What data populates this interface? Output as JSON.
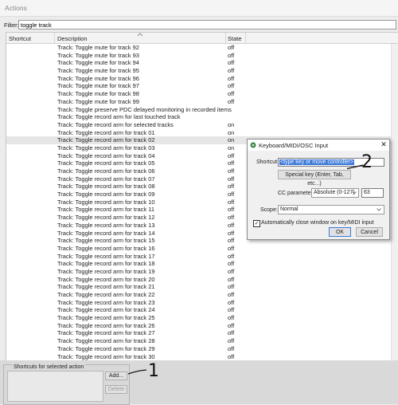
{
  "window": {
    "title": "Actions"
  },
  "filter": {
    "label": "Filter:",
    "value": "toggle track"
  },
  "columns": {
    "shortcut": "Shortcut",
    "description": "Description",
    "state": "State"
  },
  "rows": [
    {
      "description": "Track: Toggle mute for track 92",
      "state": "off"
    },
    {
      "description": "Track: Toggle mute for track 93",
      "state": "off"
    },
    {
      "description": "Track: Toggle mute for track 94",
      "state": "off"
    },
    {
      "description": "Track: Toggle mute for track 95",
      "state": "off"
    },
    {
      "description": "Track: Toggle mute for track 96",
      "state": "off"
    },
    {
      "description": "Track: Toggle mute for track 97",
      "state": "off"
    },
    {
      "description": "Track: Toggle mute for track 98",
      "state": "off"
    },
    {
      "description": "Track: Toggle mute for track 99",
      "state": "off"
    },
    {
      "description": "Track: Toggle preserve PDC delayed monitoring in recorded items",
      "state": ""
    },
    {
      "description": "Track: Toggle record arm for last touched track",
      "state": ""
    },
    {
      "description": "Track: Toggle record arm for selected tracks",
      "state": "on"
    },
    {
      "description": "Track: Toggle record arm for track 01",
      "state": "on"
    },
    {
      "description": "Track: Toggle record arm for track 02",
      "state": "on",
      "selected": true
    },
    {
      "description": "Track: Toggle record arm for track 03",
      "state": "on"
    },
    {
      "description": "Track: Toggle record arm for track 04",
      "state": "off"
    },
    {
      "description": "Track: Toggle record arm for track 05",
      "state": "off"
    },
    {
      "description": "Track: Toggle record arm for track 06",
      "state": "off"
    },
    {
      "description": "Track: Toggle record arm for track 07",
      "state": "off"
    },
    {
      "description": "Track: Toggle record arm for track 08",
      "state": "off"
    },
    {
      "description": "Track: Toggle record arm for track 09",
      "state": "off"
    },
    {
      "description": "Track: Toggle record arm for track 10",
      "state": "off"
    },
    {
      "description": "Track: Toggle record arm for track 11",
      "state": "off"
    },
    {
      "description": "Track: Toggle record arm for track 12",
      "state": "off"
    },
    {
      "description": "Track: Toggle record arm for track 13",
      "state": "off"
    },
    {
      "description": "Track: Toggle record arm for track 14",
      "state": "off"
    },
    {
      "description": "Track: Toggle record arm for track 15",
      "state": "off"
    },
    {
      "description": "Track: Toggle record arm for track 16",
      "state": "off"
    },
    {
      "description": "Track: Toggle record arm for track 17",
      "state": "off"
    },
    {
      "description": "Track: Toggle record arm for track 18",
      "state": "off"
    },
    {
      "description": "Track: Toggle record arm for track 19",
      "state": "off"
    },
    {
      "description": "Track: Toggle record arm for track 20",
      "state": "off"
    },
    {
      "description": "Track: Toggle record arm for track 21",
      "state": "off"
    },
    {
      "description": "Track: Toggle record arm for track 22",
      "state": "off"
    },
    {
      "description": "Track: Toggle record arm for track 23",
      "state": "off"
    },
    {
      "description": "Track: Toggle record arm for track 24",
      "state": "off"
    },
    {
      "description": "Track: Toggle record arm for track 25",
      "state": "off"
    },
    {
      "description": "Track: Toggle record arm for track 26",
      "state": "off"
    },
    {
      "description": "Track: Toggle record arm for track 27",
      "state": "off"
    },
    {
      "description": "Track: Toggle record arm for track 28",
      "state": "off"
    },
    {
      "description": "Track: Toggle record arm for track 29",
      "state": "off"
    },
    {
      "description": "Track: Toggle record arm for track 30",
      "state": "off"
    }
  ],
  "bottom": {
    "group_label": "Shortcuts for selected action",
    "add_label": "Add...",
    "delete_label": "Delete"
  },
  "dialog": {
    "title": "Keyboard/MIDI/OSC Input",
    "close_glyph": "✕",
    "shortcut_label": "Shortcut:",
    "shortcut_value": "<type key or move controller>",
    "special_key_label": "Special key (Enter, Tab, etc...)",
    "cc_label": "CC parameter:",
    "cc_mode": "Absolute (0-127)",
    "cc_value": "63",
    "scope_label": "Scope:",
    "scope_value": "Normal",
    "auto_close_label": "Automatically close window on key/MIDI input",
    "auto_close_checked": true,
    "ok_label": "OK",
    "cancel_label": "Cancel"
  },
  "annotations": {
    "mark1": "1",
    "mark2": "2"
  }
}
